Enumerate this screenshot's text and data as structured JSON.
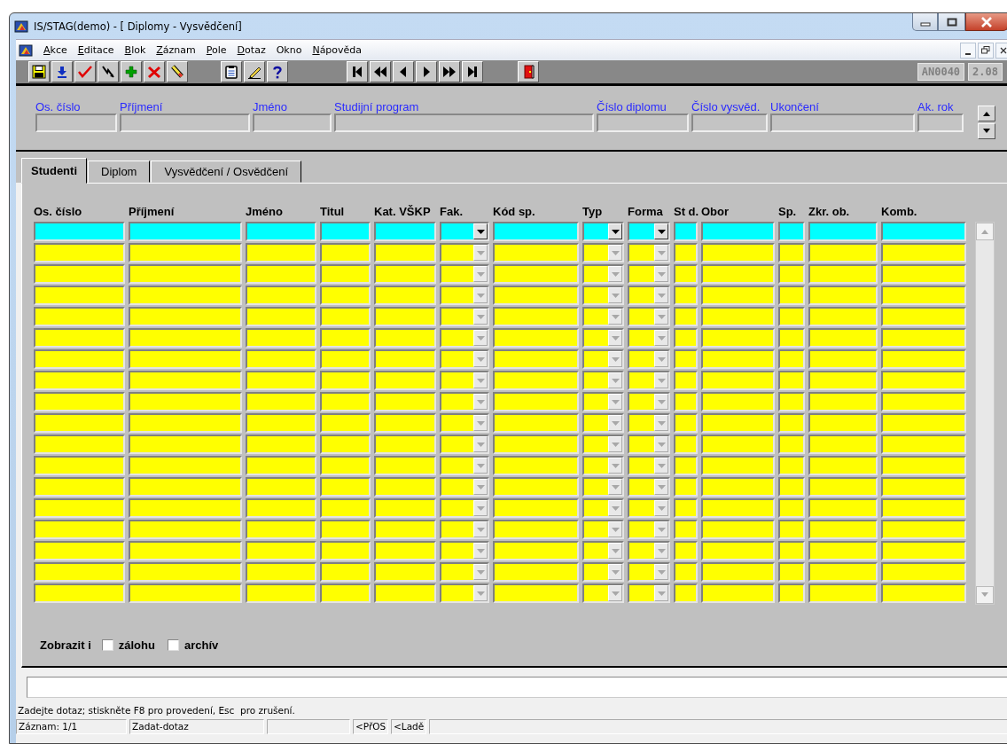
{
  "window": {
    "title": "IS/STAG(demo) - [ Diplomy - Vysvědčení]"
  },
  "menu": [
    {
      "label": "Akce",
      "underlined": true
    },
    {
      "label": "Editace",
      "underlined": true
    },
    {
      "label": "Blok",
      "underlined": true
    },
    {
      "label": "Záznam",
      "underlined": true
    },
    {
      "label": "Pole",
      "underlined": true
    },
    {
      "label": "Dotaz",
      "underlined": true
    },
    {
      "label": "Okno",
      "underlined": false
    },
    {
      "label": "Nápověda",
      "underlined": true
    }
  ],
  "toolbar": {
    "groups": [
      [
        {
          "kind": "save"
        },
        {
          "kind": "download"
        },
        {
          "kind": "check"
        },
        {
          "kind": "lightning"
        },
        {
          "kind": "add"
        },
        {
          "kind": "delete"
        },
        {
          "kind": "eraser"
        }
      ],
      [
        {
          "kind": "clipboard"
        },
        {
          "kind": "pencil"
        },
        {
          "kind": "help"
        }
      ],
      [
        {
          "kind": "first"
        },
        {
          "kind": "prev_set"
        },
        {
          "kind": "prev"
        },
        {
          "kind": "next"
        },
        {
          "kind": "next_set"
        },
        {
          "kind": "last"
        }
      ],
      [
        {
          "kind": "exit"
        }
      ]
    ],
    "badges": [
      "AN0040",
      "2.08"
    ]
  },
  "header": {
    "fields": [
      {
        "label": "Os. číslo"
      },
      {
        "label": "Příjmení"
      },
      {
        "label": "Jméno"
      },
      {
        "label": "Studijní program"
      },
      {
        "label": "Číslo diplomu"
      },
      {
        "label": "Číslo vysvěd."
      },
      {
        "label": "Ukončení"
      },
      {
        "label": "Ak. rok"
      }
    ]
  },
  "tabs": [
    {
      "label": "Studenti",
      "selected": true
    },
    {
      "label": "Diplom",
      "selected": false
    },
    {
      "label": "Vysvědčení / Osvědčení",
      "selected": false
    }
  ],
  "table": {
    "columns": [
      {
        "label": "Os. číslo",
        "kind": "text"
      },
      {
        "label": "Příjmení",
        "kind": "text"
      },
      {
        "label": "Jméno",
        "kind": "text"
      },
      {
        "label": "Titul",
        "kind": "text"
      },
      {
        "label": "Kat. VŠKP",
        "kind": "text"
      },
      {
        "label": "Fak.",
        "kind": "combo"
      },
      {
        "label": "Kód sp.",
        "kind": "text"
      },
      {
        "label": "Typ",
        "kind": "combo"
      },
      {
        "label": "Forma",
        "kind": "combo"
      },
      {
        "label": "St d.",
        "kind": "text"
      },
      {
        "label": "Obor",
        "kind": "text"
      },
      {
        "label": "Sp.",
        "kind": "text"
      },
      {
        "label": "Zkr. ob.",
        "kind": "text"
      },
      {
        "label": "Komb.",
        "kind": "text"
      }
    ],
    "rows": [
      {
        "selected": true
      },
      {
        "selected": false
      },
      {
        "selected": false
      },
      {
        "selected": false
      },
      {
        "selected": false
      },
      {
        "selected": false
      },
      {
        "selected": false
      },
      {
        "selected": false
      },
      {
        "selected": false
      },
      {
        "selected": false
      },
      {
        "selected": false
      },
      {
        "selected": false
      },
      {
        "selected": false
      },
      {
        "selected": false
      },
      {
        "selected": false
      },
      {
        "selected": false
      },
      {
        "selected": false
      },
      {
        "selected": false
      }
    ]
  },
  "options": {
    "label": "Zobrazit i",
    "checkboxes": [
      {
        "label": "zálohu",
        "checked": false
      },
      {
        "label": "archív",
        "checked": false
      }
    ]
  },
  "status_bar": {
    "message": "Zadejte dotaz; stiskněte F8 pro provedení, Esc  pro zrušení.",
    "cells": [
      {
        "text": "Záznam: 1/1"
      },
      {
        "text": "Zadat-dotaz"
      },
      {
        "kind": "blank"
      },
      {
        "text": "<PřOS"
      },
      {
        "text": "<Ladě"
      },
      {
        "kind": "blank"
      }
    ]
  }
}
